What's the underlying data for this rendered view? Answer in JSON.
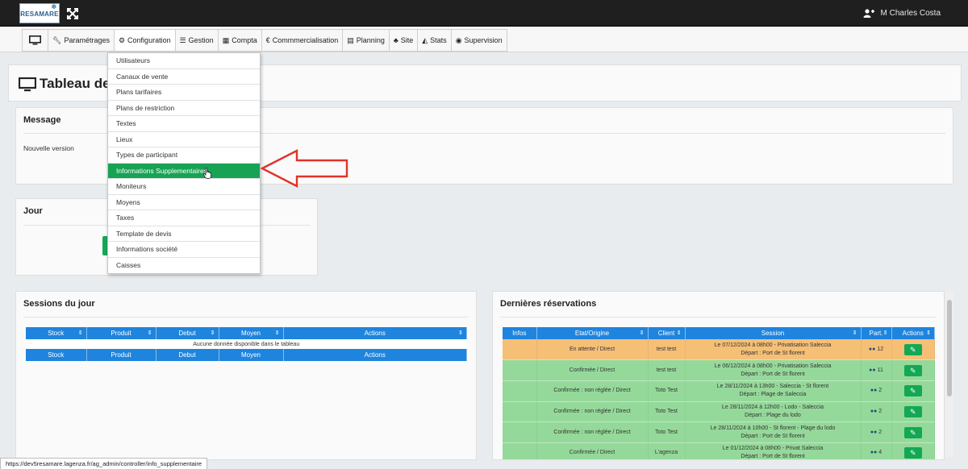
{
  "app": {
    "logo_text": "RESAMARE",
    "user_name": "M Charles Costa"
  },
  "nav": [
    {
      "label": "",
      "icon": "monitor-icon"
    },
    {
      "label": "Paramétrages",
      "icon": "wrench-icon"
    },
    {
      "label": "Configuration",
      "icon": "cogs-icon"
    },
    {
      "label": "Gestion",
      "icon": "list-icon"
    },
    {
      "label": "Compta",
      "icon": "calculator-icon"
    },
    {
      "label": "Commmercialisation",
      "icon": "euro-icon"
    },
    {
      "label": "Planning",
      "icon": "calendar-icon"
    },
    {
      "label": "Site",
      "icon": "sitemap-icon"
    },
    {
      "label": "Stats",
      "icon": "area-chart-icon"
    },
    {
      "label": "Supervision",
      "icon": "eye-icon"
    }
  ],
  "dropdown": {
    "items": [
      "Utilisateurs",
      "Canaux de vente",
      "Plans tarifaires",
      "Plans de restriction",
      "Textes",
      "Lieux",
      "Types de participant",
      "Informations Supplementaires",
      "Moniteurs",
      "Moyens",
      "Taxes",
      "Template de devis",
      "Informations société",
      "Caisses"
    ],
    "selected_index": 7
  },
  "page": {
    "title": "Tableau de bord"
  },
  "message_panel": {
    "title": "Message",
    "text": "Nouvelle version"
  },
  "jour_panel": {
    "title": "Jour"
  },
  "sessions": {
    "title": "Sessions du jour",
    "columns": [
      "Stock",
      "Produit",
      "Debut",
      "Moyen",
      "Actions"
    ],
    "footer_columns": [
      "Stock",
      "Produit",
      "Debut",
      "Moyen",
      "Actions"
    ],
    "empty_text": "Aucune donnée disponible dans le tableau"
  },
  "reservations": {
    "title": "Dernières réservations",
    "columns": [
      "Infos",
      "Etat/Origine",
      "Client",
      "Session",
      "Part.",
      "Actions"
    ],
    "rows": [
      {
        "etat": "En attente / Direct",
        "client": "test test",
        "session1": "Le 07/12/2024 à 08h00 - Privatisation Saleccia",
        "session2": "Départ : Port de St florent",
        "part": "12",
        "status": "orange"
      },
      {
        "etat": "Confirmée / Direct",
        "client": "test test",
        "session1": "Le 06/12/2024 à 08h00 - Privatisation Saleccia",
        "session2": "Départ : Port de St florent",
        "part": "11",
        "status": "green"
      },
      {
        "etat": "Confirmée : non réglée / Direct",
        "client": "Toto Test",
        "session1": "Le 28/11/2024 à 13h00 - Saleccia - St florent",
        "session2": "Départ : Plage de Saleccia",
        "part": "2",
        "status": "green"
      },
      {
        "etat": "Confirmée : non réglée / Direct",
        "client": "Toto Test",
        "session1": "Le 28/11/2024 à 12h00 - Lodo - Saleccia",
        "session2": "Départ : Plage du lodo",
        "part": "2",
        "status": "green"
      },
      {
        "etat": "Confirmée : non réglée / Direct",
        "client": "Toto Test",
        "session1": "Le 28/11/2024 à 10h00 - St florent - Plage du lodo",
        "session2": "Départ : Port de St florent",
        "part": "2",
        "status": "green"
      },
      {
        "etat": "Confirmée / Direct",
        "client": "L'agenza",
        "session1": "Le 01/12/2024 à 08h00 - Privat Saleccia",
        "session2": "Départ : Port de St florent",
        "part": "4",
        "status": "green"
      }
    ]
  },
  "status_bar": {
    "url": "https://dev5resamare.lagenza.fr/ag_admin/controller/info_supplementaire"
  },
  "colors": {
    "header_bg": "#1f1f1f",
    "table_header": "#1f84dd",
    "selected": "#17a254",
    "pending_row": "#f5bf76",
    "confirmed_row": "#95d99a",
    "arrow": "#e0332a"
  }
}
